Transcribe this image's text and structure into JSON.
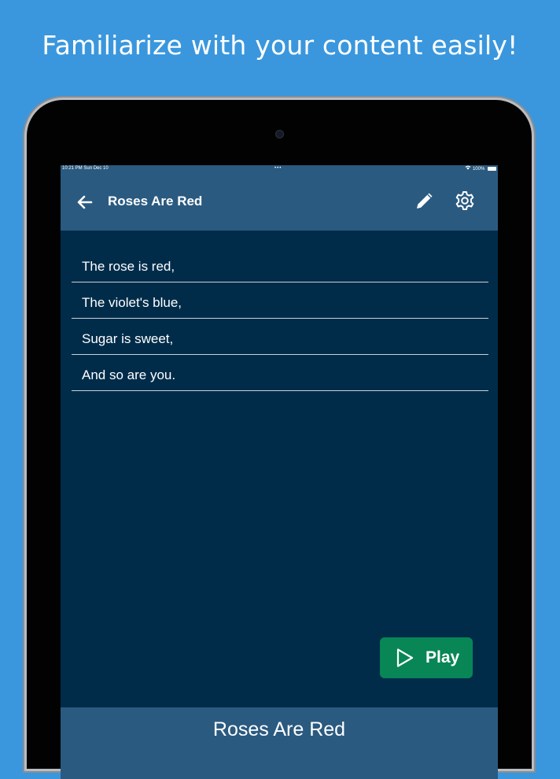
{
  "headline": "Familiarize with your content easily!",
  "status_bar": {
    "time_date": "10:21 PM   Sun Dec 10",
    "dots": "•••",
    "battery": "100%"
  },
  "app_bar": {
    "title": "Roses Are Red"
  },
  "lines": [
    "The rose is red,",
    "The violet's blue,",
    "Sugar is sweet,",
    "And so are you."
  ],
  "play_button": {
    "label": "Play"
  },
  "bottom_bar": {
    "title": "Roses Are Red"
  },
  "colors": {
    "background": "#3a97dd",
    "app_bar": "#2a5a80",
    "content": "#002c4a",
    "play_button": "#088656"
  }
}
